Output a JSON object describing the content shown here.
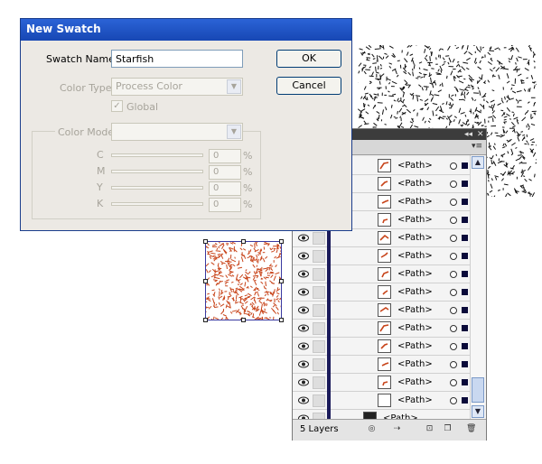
{
  "dialog": {
    "title": "New Swatch",
    "swatch_name_label": "Swatch Name:",
    "swatch_name_value": "Starfish",
    "color_type_label": "Color Type:",
    "color_type_value": "Process Color",
    "global_label": "Global",
    "global_checked": true,
    "color_mode_label": "Color Mode:",
    "color_mode_value": "",
    "channels": [
      {
        "name": "C",
        "value": "0",
        "unit": "%"
      },
      {
        "name": "M",
        "value": "0",
        "unit": "%"
      },
      {
        "name": "Y",
        "value": "0",
        "unit": "%"
      },
      {
        "name": "K",
        "value": "0",
        "unit": "%"
      }
    ],
    "ok_label": "OK",
    "cancel_label": "Cancel",
    "title_bar_color": "#2b63d6"
  },
  "layers_panel": {
    "collapse_icon": "double-chevron-icon",
    "close_icon": "close-icon",
    "menu_icon": "panel-menu-icon",
    "path_label": "<Path>",
    "rows": [
      {
        "label": "<Path>"
      },
      {
        "label": "<Path>"
      },
      {
        "label": "<Path>"
      },
      {
        "label": "<Path>"
      },
      {
        "label": "<Path>"
      },
      {
        "label": "<Path>"
      },
      {
        "label": "<Path>"
      },
      {
        "label": "<Path>"
      },
      {
        "label": "<Path>"
      },
      {
        "label": "<Path>"
      },
      {
        "label": "<Path>"
      },
      {
        "label": "<Path>"
      },
      {
        "label": "<Path>"
      },
      {
        "label": "<Path>"
      },
      {
        "label": "<Path>"
      }
    ],
    "layer_count": "5 Layers",
    "accent_color": "#1a1a5a",
    "art_color": "#c8441a"
  }
}
